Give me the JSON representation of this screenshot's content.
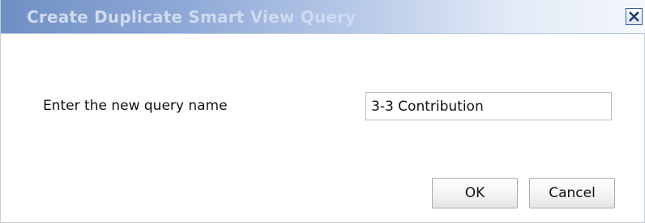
{
  "dialog": {
    "title": "Create Duplicate Smart View Query",
    "close_icon": "close-icon",
    "prompt_label": "Enter the new query name",
    "query_name_value": "3-3 Contribution",
    "ok_label": "OK",
    "cancel_label": "Cancel"
  },
  "colors": {
    "titlebar_start": "#6f8fc4",
    "titlebar_end": "#f4f7fc",
    "close_border": "#3b5e9e"
  }
}
